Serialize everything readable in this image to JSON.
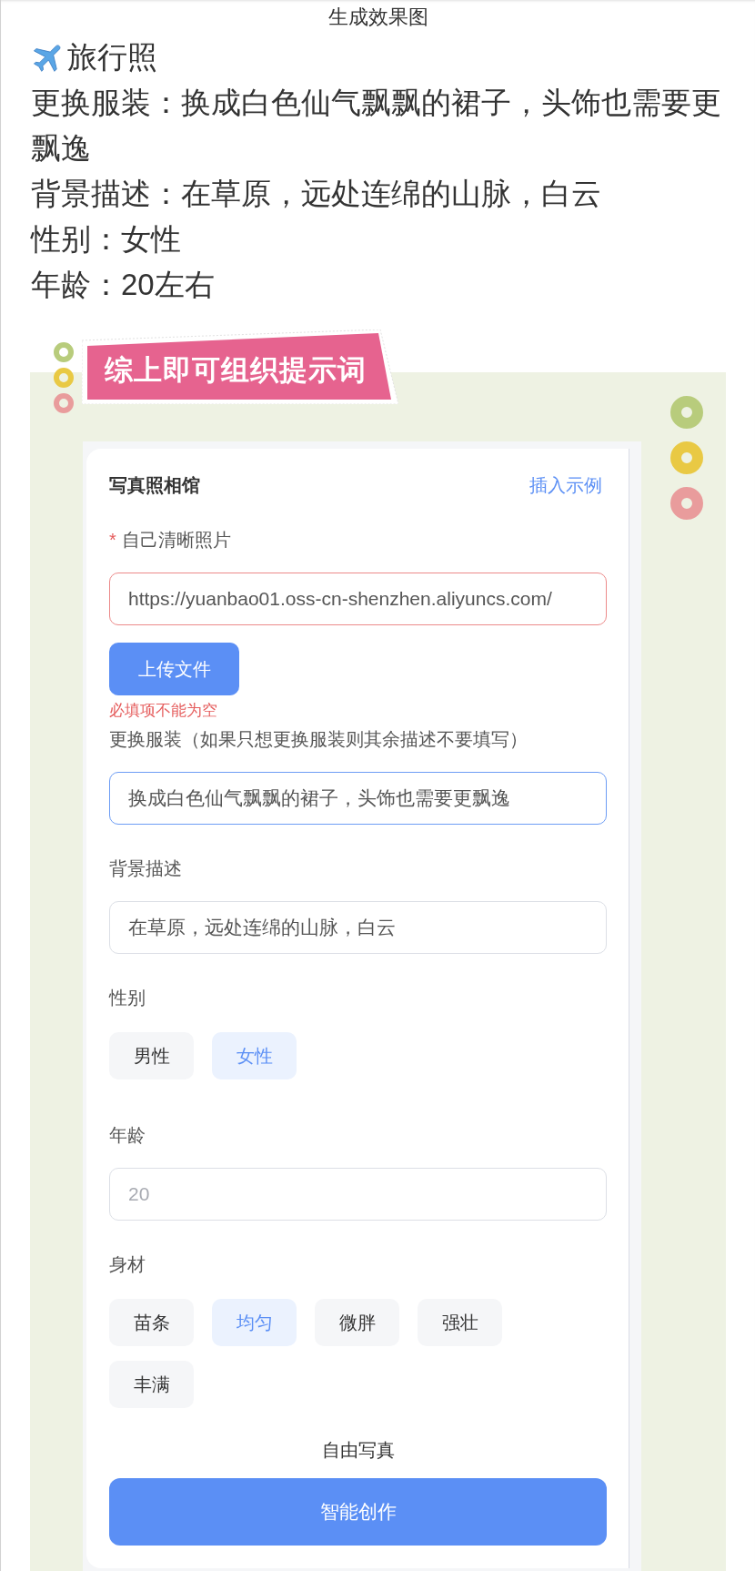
{
  "page_title": "生成效果图",
  "notes": {
    "title": "旅行照",
    "lines": [
      "更换服装：换成白色仙气飘飘的裙子，头饰也需要更飘逸",
      "背景描述：在草原，远处连绵的山脉，白云",
      "性别：女性",
      "年龄：20左右"
    ]
  },
  "banner": {
    "text": "综上即可组织提示词"
  },
  "form": {
    "title": "写真照相馆",
    "example_link": "插入示例",
    "fields": [
      {
        "kind": "upload",
        "required_mark": "*",
        "label": "自己清晰照片",
        "value": "https://yuanbao01.oss-cn-shenzhen.aliyuncs.com/",
        "button": "上传文件",
        "error": "必填项不能为空"
      },
      {
        "kind": "text",
        "label": "更换服装（如果只想更换服装则其余描述不要填写）",
        "value": "换成白色仙气飘飘的裙子，头饰也需要更飘逸",
        "focused": true
      },
      {
        "kind": "text",
        "label": "背景描述",
        "value": "在草原，远处连绵的山脉，白云",
        "focused": false
      },
      {
        "kind": "choice",
        "label": "性别",
        "options": [
          {
            "label": "男性",
            "selected": false
          },
          {
            "label": "女性",
            "selected": true
          }
        ]
      },
      {
        "kind": "text",
        "label": "年龄",
        "placeholder": "20",
        "focused": false
      },
      {
        "kind": "choice",
        "label": "身材",
        "options": [
          {
            "label": "苗条",
            "selected": false
          },
          {
            "label": "均匀",
            "selected": true
          },
          {
            "label": "微胖",
            "selected": false
          },
          {
            "label": "强壮",
            "selected": false
          },
          {
            "label": "丰满",
            "selected": false
          }
        ]
      }
    ],
    "mode_label": "自由写真",
    "submit": "智能创作"
  }
}
